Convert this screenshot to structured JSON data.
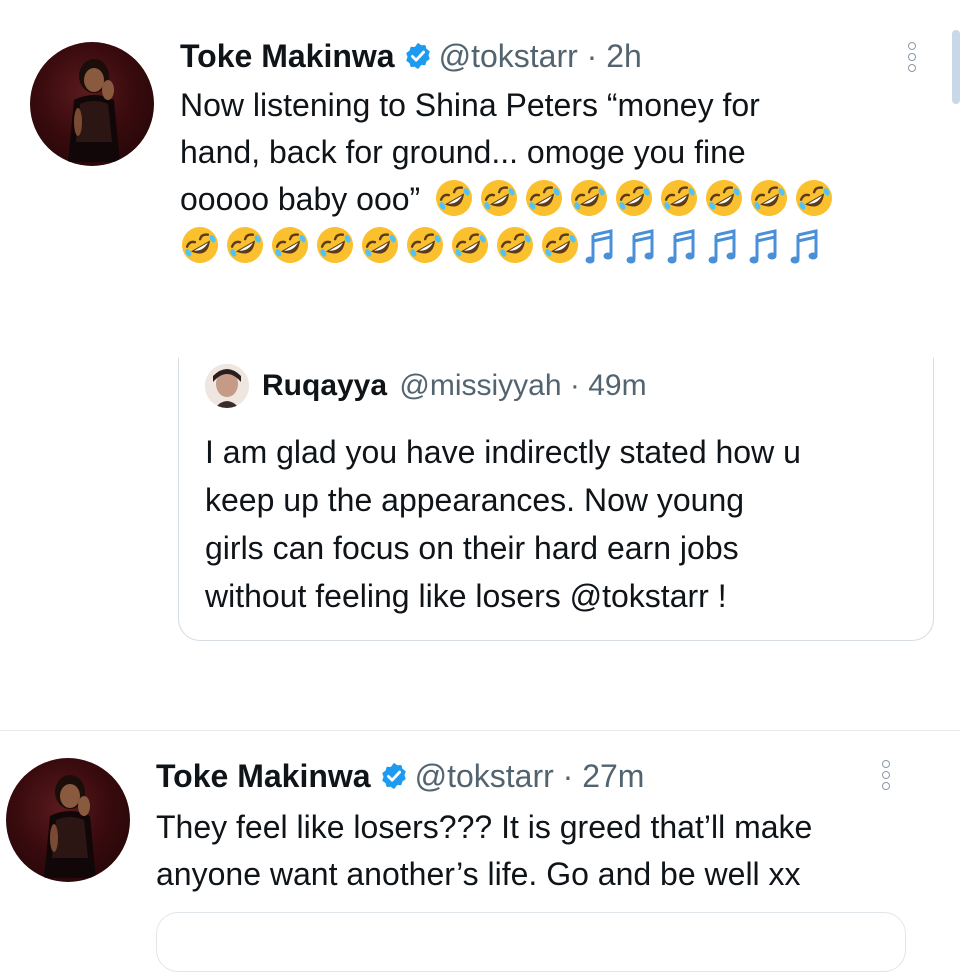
{
  "tweet1": {
    "name": "Toke Makinwa",
    "handle": "@tokstarr",
    "time": "· 2h",
    "text_lines": [
      "Now listening to Shina Peters “money for",
      "hand, back for ground... omoge you fine",
      "ooooo baby ooo”"
    ]
  },
  "quoted": {
    "name": "Ruqayya",
    "handle": "@missiyyah",
    "time": "· 49m",
    "text_lines": [
      "I am glad you have indirectly stated how u",
      "keep up the appearances. Now young",
      "girls can focus on their hard earn jobs",
      "without feeling like losers @tokstarr !"
    ]
  },
  "tweet2": {
    "name": "Toke Makinwa",
    "handle": "@tokstarr",
    "time": "· 27m",
    "text_lines": [
      "They feel like losers??? It is greed that’ll make",
      "anyone want another’s life. Go and be well xx"
    ]
  },
  "icons": {
    "verified": "verified-badge-icon",
    "more": "more-options-icon",
    "emoji": "rolling-on-floor-laughing-emoji",
    "music": "musical-notes-emoji"
  },
  "colors": {
    "verified_blue": "#1d9bf0",
    "secondary_text": "#536471",
    "emoji_yellow": "#fbc02d",
    "note_blue": "#4a90d9"
  }
}
